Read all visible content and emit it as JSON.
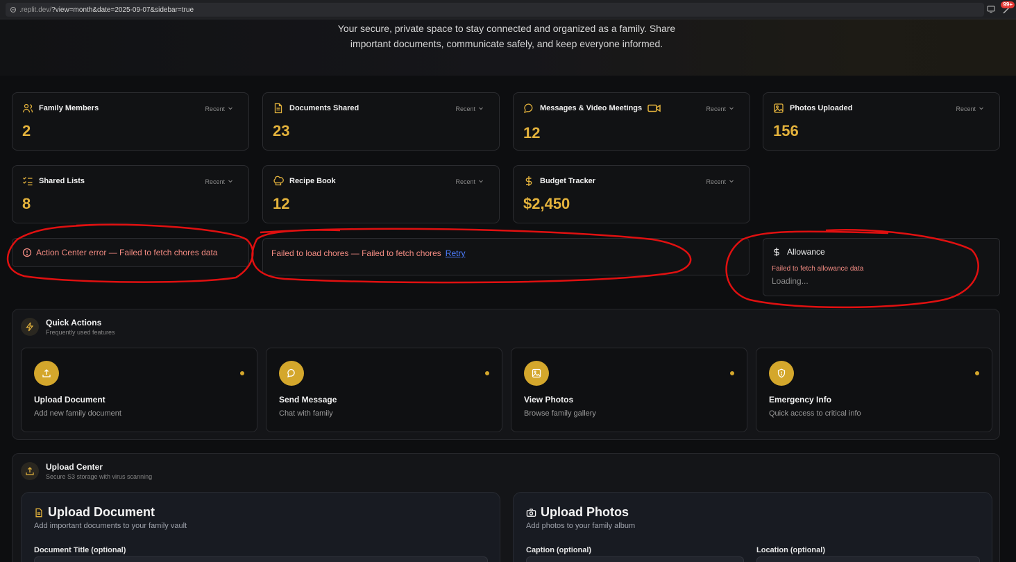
{
  "browser": {
    "url_prefix": ".replit.dev/",
    "url_query": "?view=month&date=2025-09-07&sidebar=true",
    "notification_count": "99+"
  },
  "hero": {
    "text": "Your secure, private space to stay connected and organized as a family. Share important documents, communicate safely, and keep everyone informed."
  },
  "stats": [
    {
      "icon": "users-icon",
      "title": "Family Members",
      "recent": "Recent",
      "value": "2"
    },
    {
      "icon": "document-icon",
      "title": "Documents Shared",
      "recent": "Recent",
      "value": "23"
    },
    {
      "icon": "chat-bubble-icon",
      "title": "Messages  &  Video Meetings",
      "recent": "Recent",
      "value": "12"
    },
    {
      "icon": "image-icon",
      "title": "Photos Uploaded",
      "recent": "Recent",
      "value": "156"
    },
    {
      "icon": "checklist-icon",
      "title": "Shared Lists",
      "recent": "Recent",
      "value": "8"
    },
    {
      "icon": "chef-hat-icon",
      "title": "Recipe Book",
      "recent": "Recent",
      "value": "12"
    },
    {
      "icon": "dollar-icon",
      "title": "Budget Tracker",
      "recent": "Recent",
      "value": "$2,450"
    }
  ],
  "errors": {
    "action_center": "Action Center error — Failed to fetch chores data",
    "chores": "Failed to load chores — Failed to fetch chores",
    "retry": "Retry",
    "allowance_title": "Allowance",
    "allowance_error": "Failed to fetch allowance data",
    "allowance_loading": "Loading..."
  },
  "quick_actions": {
    "title": "Quick Actions",
    "subtitle": "Frequently used features",
    "items": [
      {
        "icon": "upload-icon",
        "title": "Upload Document",
        "subtitle": "Add new family document"
      },
      {
        "icon": "message-icon",
        "title": "Send Message",
        "subtitle": "Chat with family"
      },
      {
        "icon": "photo-icon",
        "title": "View Photos",
        "subtitle": "Browse family gallery"
      },
      {
        "icon": "shield-alert-icon",
        "title": "Emergency Info",
        "subtitle": "Quick access to critical info"
      }
    ]
  },
  "upload_center": {
    "title": "Upload Center",
    "subtitle": "Secure S3 storage with virus scanning",
    "document": {
      "title": "Upload Document",
      "subtitle": "Add important documents to your family vault",
      "field_label": "Document Title (optional)"
    },
    "photos": {
      "title": "Upload Photos",
      "subtitle": "Add photos to your family album",
      "caption_label": "Caption (optional)",
      "location_label": "Location (optional)"
    }
  },
  "colors": {
    "accent": "#e3b23c",
    "error": "#f28b82",
    "link": "#4c7dff",
    "annotation": "#e01010"
  }
}
